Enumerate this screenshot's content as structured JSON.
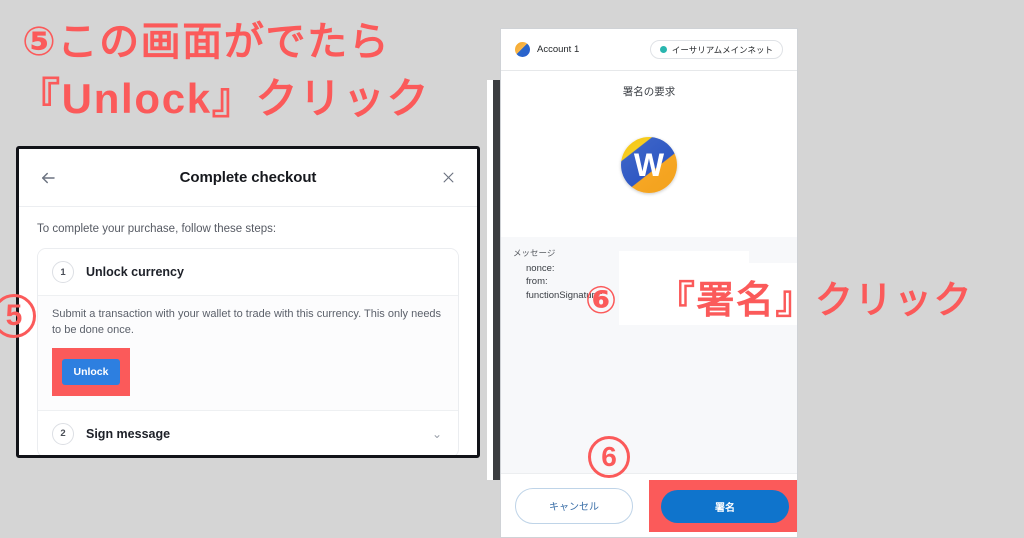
{
  "page": {
    "background_color": "#d5d5d5",
    "accent_red": "#fb5a5a"
  },
  "annotations": {
    "left_line1": "⑤この画面がでたら",
    "left_line2": "『Unlock』クリック",
    "right_line": "『署名』クリック",
    "marker_unlock": "5",
    "marker_sign": "6",
    "marker_right_inline": "⑥"
  },
  "checkout_dialog": {
    "back_icon": "back-arrow-icon",
    "close_icon": "close-icon",
    "title": "Complete checkout",
    "intro": "To complete your purchase, follow these steps:",
    "steps": [
      {
        "number": "1",
        "label": "Unlock currency",
        "description": "Submit a transaction with your wallet to trade with this currency. This only needs to be done once.",
        "action_label": "Unlock",
        "action_color": "#2d7fe0"
      },
      {
        "number": "2",
        "label": "Sign message",
        "chevron": "⌄"
      }
    ]
  },
  "metamask": {
    "account_name": "Account 1",
    "account_avatar": "account-avatar-icon",
    "network_name": "イーサリアムメインネット",
    "network_dot_color": "#29b6af",
    "request_title": "署名の要求",
    "site_logo_letter": "W",
    "message": {
      "heading": "メッセージ",
      "lines": [
        "nonce:",
        "from:",
        "functionSignature:"
      ]
    },
    "footer": {
      "cancel_label": "キャンセル",
      "sign_label": "署名",
      "sign_color": "#0f74cc"
    }
  }
}
